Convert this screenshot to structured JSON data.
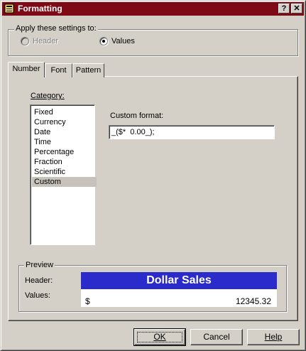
{
  "window": {
    "title": "Formatting",
    "help_glyph": "?",
    "close_glyph": "✕"
  },
  "apply": {
    "group_label": "Apply these settings to:",
    "options": [
      {
        "label": "Header",
        "selected": false,
        "disabled": true
      },
      {
        "label": "Values",
        "selected": true,
        "disabled": false
      }
    ]
  },
  "tabs": [
    {
      "label": "Number",
      "active": true
    },
    {
      "label": "Font",
      "active": false
    },
    {
      "label": "Pattern",
      "active": false
    }
  ],
  "category": {
    "label": "Category:",
    "items": [
      "Fixed",
      "Currency",
      "Date",
      "Time",
      "Percentage",
      "Fraction",
      "Scientific",
      "Custom"
    ],
    "selected": "Custom"
  },
  "custom_format": {
    "label": "Custom format:",
    "value": "_($*  0.00_);"
  },
  "preview": {
    "group_label": "Preview",
    "header_label": "Header:",
    "values_label": "Values:",
    "header_text": "Dollar Sales",
    "header_bg": "#2b2bcb",
    "value_symbol": "$",
    "value_number": "12345.32"
  },
  "buttons": {
    "ok": "OK",
    "cancel": "Cancel",
    "help": "Help"
  },
  "colors": {
    "title_bar": "#7e0a16",
    "face": "#d4d0c8"
  }
}
